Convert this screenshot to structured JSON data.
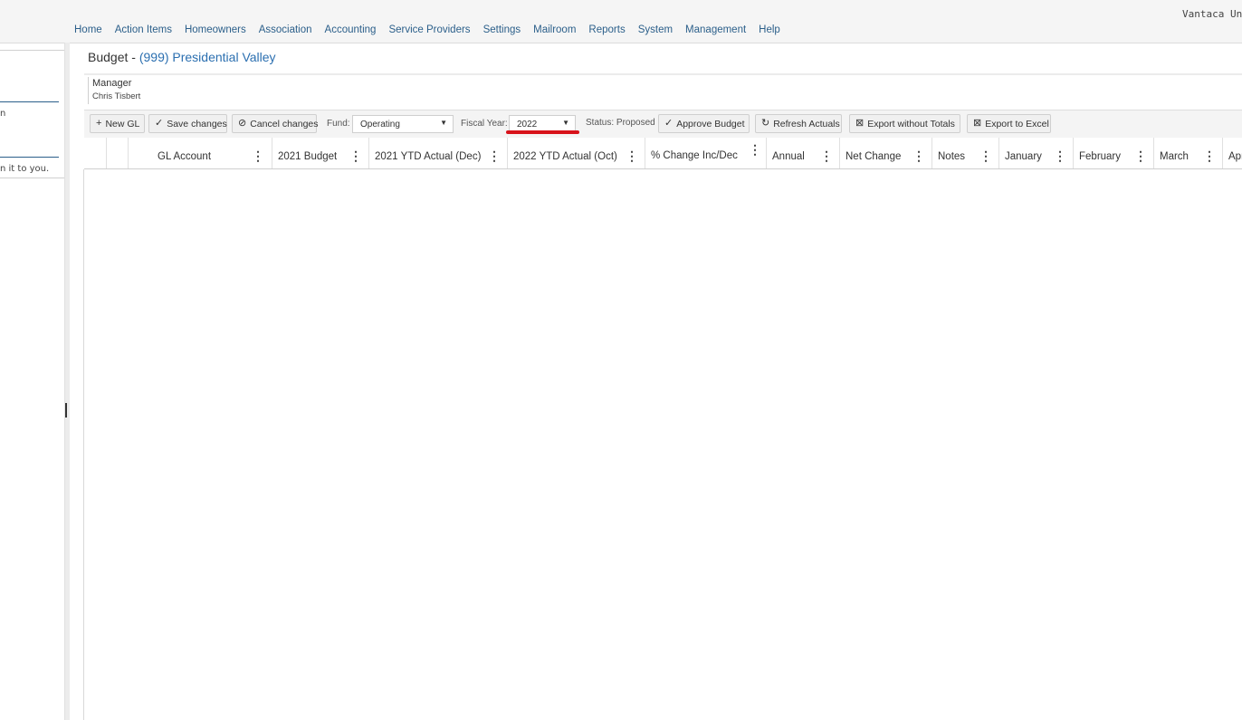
{
  "app": {
    "brand": "Vantaca Un"
  },
  "nav": {
    "items": [
      "Home",
      "Action Items",
      "Homeowners",
      "Association",
      "Accounting",
      "Service Providers",
      "Settings",
      "Mailroom",
      "Reports",
      "System",
      "Management",
      "Help"
    ]
  },
  "left_panel": {
    "text_1": "n",
    "text_2": "n it to you."
  },
  "page": {
    "title_prefix": "Budget - ",
    "title_link": "(999) Presidential Valley"
  },
  "manager": {
    "label": "Manager",
    "value": "Chris Tisbert"
  },
  "toolbar": {
    "new_gl": "New GL",
    "save": "Save changes",
    "cancel": "Cancel changes",
    "fund_label": "Fund:",
    "fund_value": "Operating",
    "fiscal_label": "Fiscal Year:",
    "fiscal_value": "2022",
    "status": "Status: Proposed",
    "approve": "Approve Budget",
    "refresh": "Refresh Actuals",
    "export_no_totals": "Export without Totals",
    "export_excel": "Export to Excel"
  },
  "grid": {
    "columns": [
      "GL Account",
      "2021 Budget",
      "2021 YTD Actual (Dec)",
      "2022 YTD Actual (Oct)",
      "% Change Inc/Dec",
      "Annual",
      "Net Change",
      "Notes",
      "January",
      "February",
      "March",
      "Apr"
    ]
  },
  "colors": {
    "accent": "#2b5f8a",
    "link": "#2b6fb0",
    "annotation": "#d8131b"
  }
}
